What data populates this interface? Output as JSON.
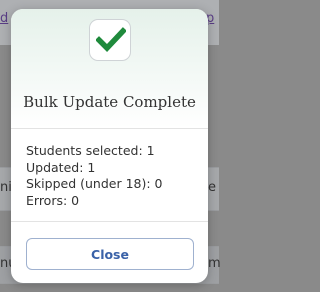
{
  "modal": {
    "title": "Bulk Update Complete",
    "icon": "check-icon",
    "stats": [
      "Students selected: 1",
      "Updated: 1",
      "Skipped (under 18): 0",
      "Errors: 0"
    ],
    "close_label": "Close"
  },
  "colors": {
    "check": "#1f8a3c",
    "button_text": "#3a62a8",
    "link": "#5a3e86"
  }
}
